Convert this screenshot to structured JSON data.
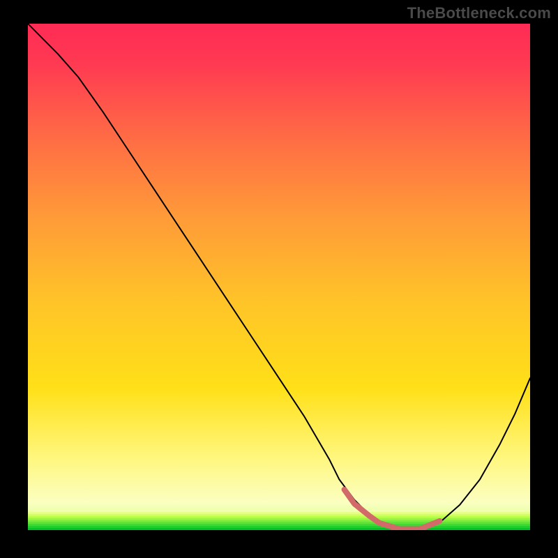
{
  "watermark": "TheBottleneck.com",
  "chart_data": {
    "type": "line",
    "title": "",
    "xlabel": "",
    "ylabel": "",
    "xlim": [
      0,
      100
    ],
    "ylim": [
      0,
      100
    ],
    "grid": false,
    "legend": false,
    "series": [
      {
        "name": "curve",
        "color": "#000000",
        "width": 2,
        "x": [
          0,
          3,
          6,
          10,
          15,
          20,
          25,
          30,
          35,
          40,
          45,
          50,
          55,
          60,
          62,
          65,
          68,
          70,
          74,
          78,
          82,
          86,
          90,
          94,
          97,
          100
        ],
        "y": [
          100,
          97,
          94,
          89.5,
          82.5,
          75,
          67.5,
          60,
          52.5,
          45,
          37.5,
          30,
          22.5,
          14,
          10,
          6,
          3,
          1.5,
          0.2,
          0.2,
          1.5,
          5,
          10,
          17,
          23,
          30
        ]
      },
      {
        "name": "highlight",
        "color": "#d36a6a",
        "width": 8,
        "x": [
          63,
          65,
          68,
          70,
          74,
          78,
          80,
          82
        ],
        "y": [
          8,
          5.2,
          2.8,
          1.4,
          0.2,
          0.2,
          1.0,
          1.8
        ]
      }
    ],
    "background_gradient": {
      "top_color": "#ff2b55",
      "mid_color": "#ffd400",
      "green_start_y": 4,
      "green_bands": [
        "#f2ffb0",
        "#e6ff8a",
        "#d3ff63",
        "#baff4a",
        "#9cf542",
        "#7ceb3d",
        "#5de238",
        "#3dd833",
        "#1ecf2e",
        "#00c529"
      ]
    }
  }
}
